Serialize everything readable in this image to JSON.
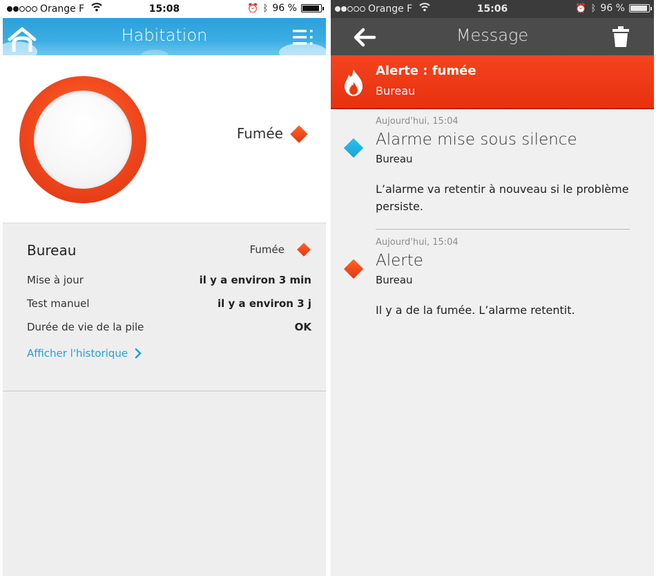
{
  "left_screen": {
    "status": {
      "carrier": "Orange F",
      "time": "15:08",
      "battery": "96 %"
    },
    "header": {
      "title": "Habitation"
    },
    "sensor": {
      "state_label": "Fumée"
    },
    "details": {
      "room": "Bureau",
      "status": "Fumée",
      "rows": [
        {
          "label": "Mise à jour",
          "value": "il y a environ 3 min"
        },
        {
          "label": "Test manuel",
          "value": "il y a environ 3 j"
        },
        {
          "label": "Durée de vie de la pile",
          "value": "OK"
        }
      ],
      "history_link": "Afficher l'historique"
    }
  },
  "right_screen": {
    "status": {
      "carrier": "Orange F",
      "time": "15:06",
      "battery": "96 %"
    },
    "header": {
      "title": "Message"
    },
    "alert": {
      "title": "Alerte : fumée",
      "room": "Bureau"
    },
    "messages": [
      {
        "timestamp": "Aujourd'hui, 15:04",
        "title": "Alarme mise sous silence",
        "room": "Bureau",
        "body": "L’alarme va retentir à nouveau si le problème persiste.",
        "indicator_color": "#1aa3d7"
      },
      {
        "timestamp": "Aujourd'hui, 15:04",
        "title": "Alerte",
        "room": "Bureau",
        "body": "Il y a de la fumée. L’alarme retentit.",
        "indicator_color": "#e53512"
      }
    ]
  },
  "colors": {
    "accent_blue": "#1aa3d7",
    "alert_red": "#e7310f",
    "header_blue": "#3aaee3",
    "header_dark": "#4b4b4b"
  }
}
